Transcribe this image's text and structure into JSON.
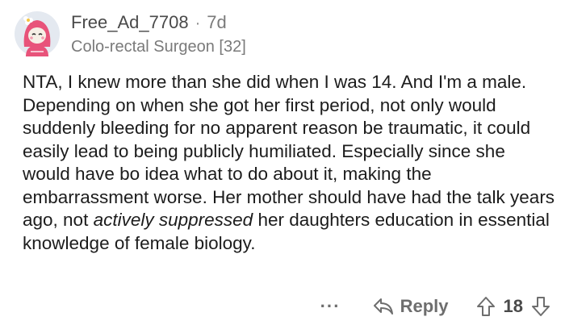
{
  "comment": {
    "username": "Free_Ad_7708",
    "separator": "·",
    "age": "7d",
    "flair": "Colo-rectal Surgeon [32]",
    "body_part1": "NTA, I knew more than she did when I was 14. And I'm a male. Depending on when she got her first period, not only would suddenly bleeding for no apparent reason be traumatic, it could easily lead to being publicly humiliated. Especially since she would have bo idea what to do about it, making the embarrassment worse. Her mother should have had the talk years ago, not ",
    "body_emphasis": "actively suppressed",
    "body_part2": " her daughters education in essential knowledge of female biology.",
    "more_label": "···",
    "reply_label": "Reply",
    "score": "18"
  },
  "icons": {
    "avatar": "snoo-avatar-pink-hood",
    "reply": "reply-arrow-icon",
    "upvote": "upvote-arrow-icon",
    "downvote": "downvote-arrow-icon"
  },
  "colors": {
    "text": "#1c1c1c",
    "meta": "#7a7a7a",
    "avatar_bg": "#e4e9f0",
    "hood": "#e8537a"
  }
}
